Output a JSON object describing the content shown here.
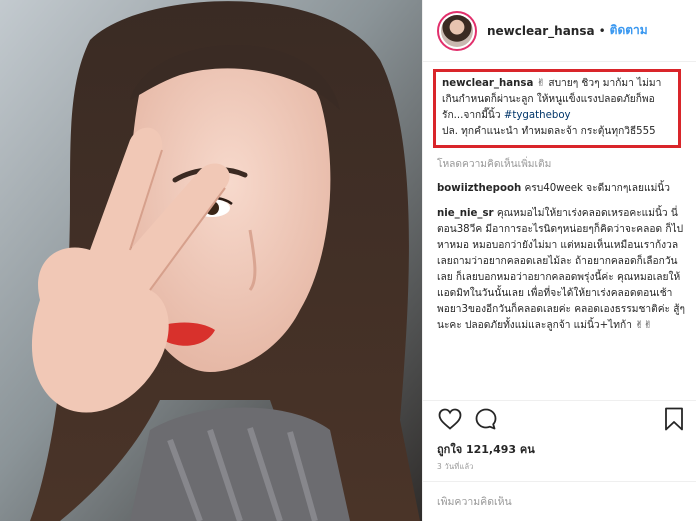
{
  "header": {
    "username": "newclear_hansa",
    "separator": "•",
    "follow_label": "ติดตาม"
  },
  "caption": {
    "username": "newclear_hansa",
    "text": "✌ สบายๆ ชิวๆ มาก้มา ไม่มาเกินกำหนดก็ผ่านะลูก ให้หนูแข็งแรงปลอดภัยก็พอ รัก...จากมี๊นิ้ว ",
    "hashtag": "#tygatheboy",
    "text2": "ปล. ทุกคำแนะนำ ทำหมดละจ้า กระตุ้นทุกวิธี555"
  },
  "load_more_label": "โหลดความคิดเห็นเพิ่มเติม",
  "comments": [
    {
      "username": "bowiizthepooh",
      "text": "ครบ40week จะดีมากๆเลยแม่นิ้ว"
    },
    {
      "username": "nie_nie_sr",
      "text": "คุณหมอไม่ให้ยาเร่งคลอดเหรอคะแม่นิ้ว นี่ตอน38วีค มีอาการอะไรนิดๆหน่อยๆก็คิดว่าจะคลอด ก็ไปหาหมอ หมอบอกว่ายังไม่มา แต่หมอเห็นเหมือนเราก้งวลเลยถามว่าอยากคลอดเลยไม้ละ ถ้าอยากคลอดก็เลือกวันเลย ก็เลยบอกหมอว่าอยากคลอดพรุ่งนี้ค่ะ คุณหมอเลยให้แอดมิทในวันนั้นเลย เพื่อที่จะได้ให้ยาเร่งคลอดตอนเช้า พอยา3ของอีกวันก็คลอดเลยค่ะ คลอดเองธรรมชาติค่ะ สู้ๆนะคะ ปลอดภัยทั้งแม่และลูกจ้า แม่นิ้ว+ไทก้า ✌✌"
    }
  ],
  "likes": "ถูกใจ 121,493 คน",
  "time_ago": "3 วันที่แล้ว",
  "add_comment_placeholder": "เพิ่มความคิดเห็น",
  "icons": {
    "like": "heart-icon",
    "comment": "comment-icon",
    "save": "bookmark-icon"
  },
  "colors": {
    "follow": "#3897f0",
    "highlight_border": "#d9252a",
    "hashtag": "#003569",
    "muted": "#999999",
    "text": "#262626"
  }
}
